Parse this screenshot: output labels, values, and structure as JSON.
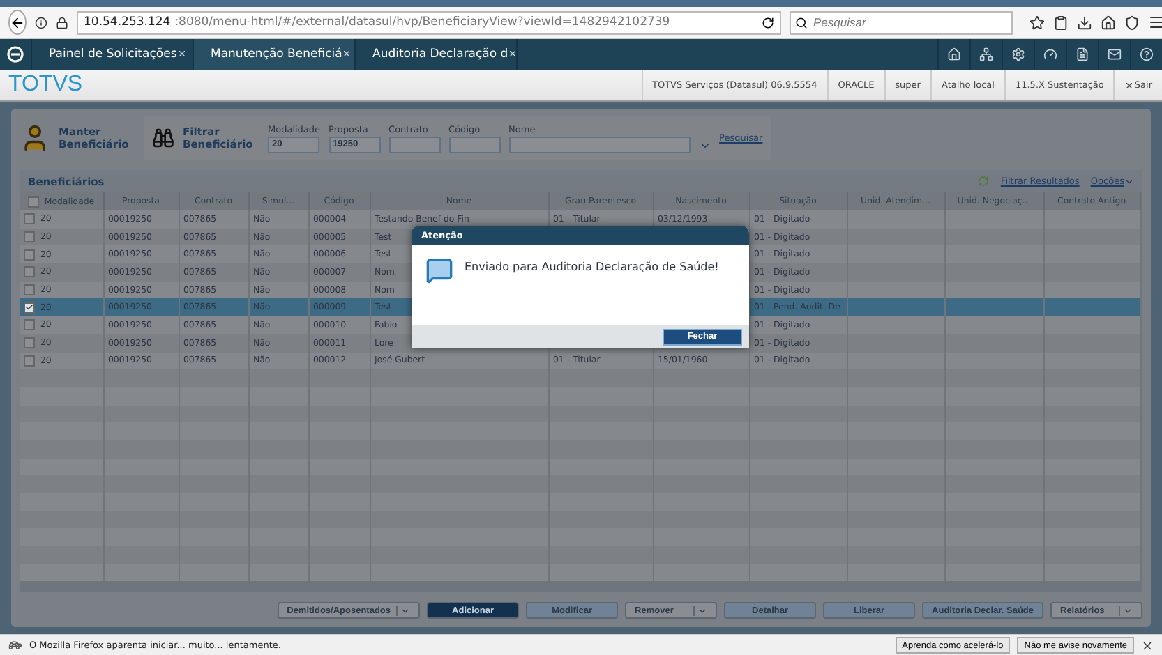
{
  "browser": {
    "url_host": "10.54.253.124",
    "url_rest": ":8080/menu-html/#/external/datasul/hvp/BeneficiaryView?viewId=1482942102739",
    "search": {
      "placeholder": "Pesquisar"
    }
  },
  "app_tabs": [
    {
      "label": "Painel de Solicitações",
      "selected": false
    },
    {
      "label": "Manutenção Beneficiá",
      "selected": true
    },
    {
      "label": "Auditoria Declaração d",
      "selected": false
    }
  ],
  "brand": "TOTVS",
  "status_items": [
    "TOTVS Serviços (Datasul) 06.9.5554",
    "ORACLE",
    "super",
    "Atalho local",
    "11.5.X Sustentação"
  ],
  "logout": "Sair",
  "header": {
    "title": "Manter Beneficiário",
    "filter_title": "Filtrar Beneficiário",
    "fields": [
      {
        "label": "Modalidade",
        "value": "20"
      },
      {
        "label": "Proposta",
        "value": "19250"
      },
      {
        "label": "Contrato"
      },
      {
        "label": "Código"
      },
      {
        "label": "Nome"
      }
    ],
    "search_link": "Pesquisar"
  },
  "grid": {
    "title": "Beneficiários",
    "filter_link": "Filtrar Resultados",
    "options": "Opções",
    "all_checked": false,
    "columns": [
      "Modalidade",
      "Proposta",
      "Contrato",
      "Simul...",
      "Código",
      "Nome",
      "Grau Parentesco",
      "Nascimento",
      "Situação",
      "Unid. Atendim...",
      "Unid. Negociaç...",
      "Contrato Antigo"
    ],
    "rows": [
      {
        "checked": false,
        "selected": false,
        "cells": [
          "20",
          "00019250",
          "007865",
          "Não",
          "000004",
          "Testando Benef do Fin",
          "01 - Titular",
          "03/12/1993",
          "01 - Digitado",
          null,
          null,
          null
        ]
      },
      {
        "checked": false,
        "selected": false,
        "cells": [
          "20",
          "00019250",
          "007865",
          "Não",
          "000005",
          "Test",
          null,
          null,
          "01 - Digitado",
          null,
          null,
          null
        ]
      },
      {
        "checked": false,
        "selected": false,
        "cells": [
          "20",
          "00019250",
          "007865",
          "Não",
          "000006",
          "Test",
          null,
          null,
          "01 - Digitado",
          null,
          null,
          null
        ]
      },
      {
        "checked": false,
        "selected": false,
        "cells": [
          "20",
          "00019250",
          "007865",
          "Não",
          "000007",
          "Nom",
          null,
          null,
          "01 - Digitado",
          null,
          null,
          null
        ]
      },
      {
        "checked": false,
        "selected": false,
        "cells": [
          "20",
          "00019250",
          "007865",
          "Não",
          "000008",
          "Nom",
          null,
          null,
          "01 - Digitado",
          null,
          null,
          null
        ]
      },
      {
        "checked": true,
        "selected": true,
        "cells": [
          "20",
          "00019250",
          "007865",
          "Não",
          "000009",
          "Test",
          null,
          null,
          "01 - Pend. Audit. De",
          null,
          null,
          null
        ]
      },
      {
        "checked": false,
        "selected": false,
        "cells": [
          "20",
          "00019250",
          "007865",
          "Não",
          "000010",
          "Fabio",
          null,
          null,
          "01 - Digitado",
          null,
          null,
          null
        ]
      },
      {
        "checked": false,
        "selected": false,
        "cells": [
          "20",
          "00019250",
          "007865",
          "Não",
          "000011",
          "Lore",
          null,
          null,
          "01 - Digitado",
          null,
          null,
          null
        ]
      },
      {
        "checked": false,
        "selected": false,
        "cells": [
          "20",
          "00019250",
          "007865",
          "Não",
          "000012",
          "José Gubert",
          "01 - Titular",
          "15/01/1960",
          "01 - Digitado",
          null,
          null,
          null
        ]
      }
    ]
  },
  "dialog": {
    "title": "Atenção",
    "message": "Enviado para Auditoria Declaração de Saúde!",
    "button": "Fechar"
  },
  "actions": [
    {
      "label": "Demitidos/Aposentados",
      "kind": "split"
    },
    {
      "label": "Adicionar",
      "kind": "primary"
    },
    {
      "label": "Modificar",
      "kind": "plain"
    },
    {
      "label": "Remover",
      "kind": "split"
    },
    {
      "label": "Detalhar",
      "kind": "plain"
    },
    {
      "label": "Liberar",
      "kind": "plain"
    },
    {
      "label": "Auditoria Declar. Saúde",
      "kind": "plain"
    },
    {
      "label": "Relatórios",
      "kind": "split"
    }
  ],
  "notification": {
    "message": "O Mozilla Firefox aparenta iniciar... muito... lentamente.",
    "buttons": [
      "Aprenda como acelerá-lo",
      "Não me avise novamente"
    ]
  }
}
